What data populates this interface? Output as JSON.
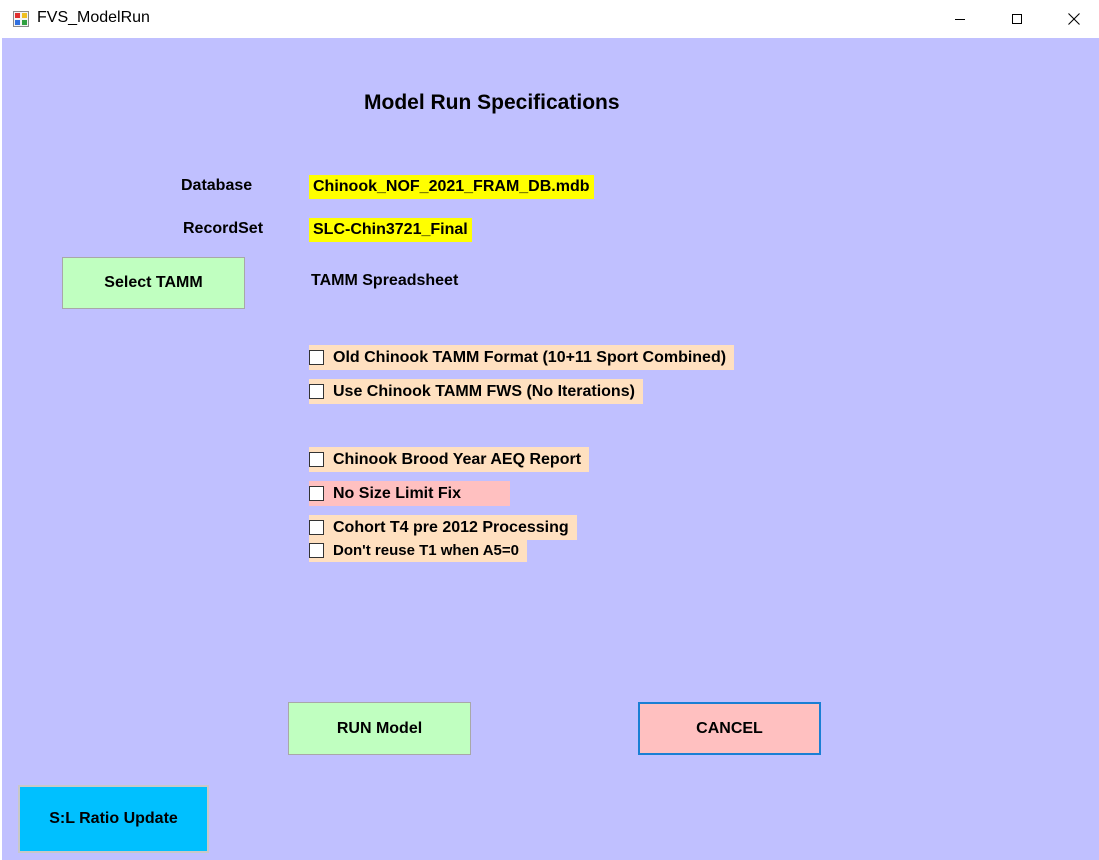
{
  "window": {
    "title": "FVS_ModelRun"
  },
  "form": {
    "heading": "Model Run Specifications",
    "database_label": "Database",
    "database_value": "Chinook_NOF_2021_FRAM_DB.mdb",
    "recordset_label": "RecordSet",
    "recordset_value": "SLC-Chin3721_Final",
    "select_tamm_label": "Select TAMM",
    "tamm_label": "TAMM Spreadsheet",
    "checkboxes": [
      {
        "label": "Old Chinook TAMM Format (10+11 Sport Combined)",
        "checked": false
      },
      {
        "label": "Use Chinook TAMM FWS (No Iterations)",
        "checked": false
      },
      {
        "label": "Chinook Brood Year AEQ Report",
        "checked": false
      },
      {
        "label": "No Size Limit Fix",
        "checked": false
      },
      {
        "label": "Cohort T4 pre 2012 Processing",
        "checked": false
      },
      {
        "label": "Don't reuse T1 when A5=0",
        "checked": false
      }
    ],
    "run_label": "RUN Model",
    "cancel_label": "CANCEL",
    "sl_ratio_label": "S:L Ratio Update"
  },
  "colors": {
    "form_background": "#c0c0ff",
    "value_highlight": "#ffff00",
    "green_button": "#c0ffc0",
    "pink_button": "#ffc0c0",
    "cyan_button": "#00c0ff",
    "option_peach": "#ffe0c0",
    "option_rose": "#ffc0c0"
  }
}
